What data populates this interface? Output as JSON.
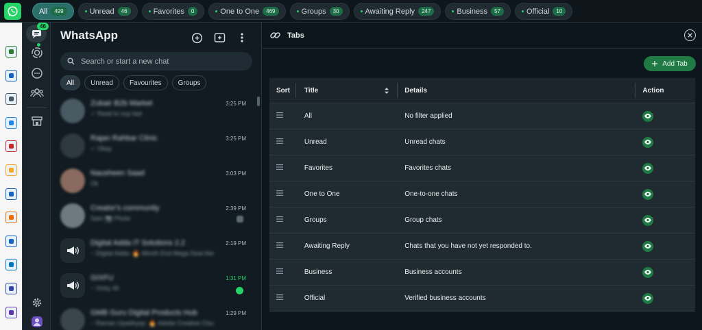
{
  "top_tabs": [
    {
      "label": "All",
      "count": "499",
      "active": true
    },
    {
      "label": "Unread",
      "count": "46",
      "active": false
    },
    {
      "label": "Favorites",
      "count": "0",
      "active": false
    },
    {
      "label": "One to One",
      "count": "469",
      "active": false
    },
    {
      "label": "Groups",
      "count": "30",
      "active": false
    },
    {
      "label": "Awaiting Reply",
      "count": "247",
      "active": false
    },
    {
      "label": "Business",
      "count": "57",
      "active": false
    },
    {
      "label": "Official",
      "count": "10",
      "active": false
    }
  ],
  "nav_rail": {
    "chats_badge": "46",
    "icons": [
      "chats-icon",
      "status-icon",
      "channels-icon",
      "communities-icon",
      "store-icon",
      "settings-icon",
      "profile-icon"
    ]
  },
  "extensions": [
    "ext-chat-icon",
    "ext-grid-icon",
    "ext-doc-icon",
    "ext-screen-icon",
    "ext-image-icon",
    "ext-bell-icon",
    "ext-list-icon",
    "ext-alert-icon",
    "ext-flow-icon",
    "ext-monitor-icon",
    "ext-globe-icon",
    "ext-user-icon"
  ],
  "chat_panel": {
    "title": "WhatsApp",
    "search_placeholder": "Search or start a new chat",
    "filters": [
      {
        "label": "All",
        "active": true
      },
      {
        "label": "Unread",
        "active": false
      },
      {
        "label": "Favourites",
        "active": false
      },
      {
        "label": "Groups",
        "active": false
      }
    ],
    "chats": [
      {
        "name": "Zubair B2b Market",
        "preview": "✓ Read to sup last",
        "time": "3:25 PM",
        "announce": false
      },
      {
        "name": "Rajan Rahbar Clinic",
        "preview": "✓ Okay",
        "time": "3:25 PM",
        "announce": false
      },
      {
        "name": "Nausheen Saad",
        "preview": "Ok",
        "time": "3:03 PM",
        "announce": false
      },
      {
        "name": "Creator's community",
        "preview": "Sam 📷 Photo",
        "time": "2:39 PM",
        "announce": false
      },
      {
        "name": "Digital Adda IT Solutions 2.2",
        "preview": "~ Digital Adda: 🔥 Month End Mega Deal Alert",
        "time": "2:19 PM",
        "announce": true
      },
      {
        "name": "GIXFU",
        "preview": "~ Vicky 45",
        "time": "1:31 PM",
        "announce": true,
        "unread": true
      },
      {
        "name": "GMB Guru Digital Products Hub",
        "preview": "~ Raman Upadhyay: 🔥 Adobe Creative Cloud",
        "time": "1:29 PM",
        "announce": false
      }
    ]
  },
  "tabs_panel": {
    "title": "Tabs",
    "add_button": "Add Tab",
    "columns": {
      "sort": "Sort",
      "title": "Title",
      "details": "Details",
      "action": "Action"
    },
    "rows": [
      {
        "title": "All",
        "details": "No filter applied"
      },
      {
        "title": "Unread",
        "details": "Unread chats"
      },
      {
        "title": "Favorites",
        "details": "Favorites chats"
      },
      {
        "title": "One to One",
        "details": "One-to-one chats"
      },
      {
        "title": "Groups",
        "details": "Group chats"
      },
      {
        "title": "Awaiting Reply",
        "details": "Chats that you have not yet responded to."
      },
      {
        "title": "Business",
        "details": "Business accounts"
      },
      {
        "title": "Official",
        "details": "Verified business accounts"
      }
    ]
  },
  "colors": {
    "accent": "#25d366",
    "button_green": "#1f7a44",
    "background": "#0b141a"
  }
}
